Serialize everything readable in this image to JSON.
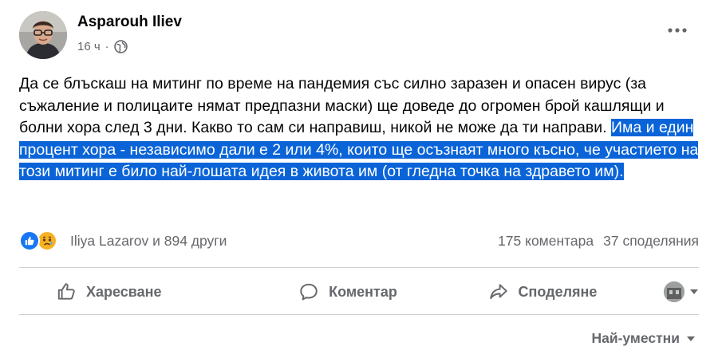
{
  "post": {
    "author": "Asparouh Iliev",
    "time": "16 ч",
    "privacy_icon": "globe-icon",
    "text_plain": "Да се блъскаш на митинг по време на пандемия със силно заразен и опасен вирус (за съжаление и полицаите нямат предпазни маски) ще доведе до огромен брой кашлящи и болни хора след 3 дни. Какво то сам си направиш, никой не може да ти направи. ",
    "text_highlighted": "Има и един процент хора - независимо дали е 2 или 4%, които ще осъзнаят много късно, че участието на този митинг е било най-лошата идея в живота им (от гледна точка на здравето им)."
  },
  "reactions": {
    "icons": [
      "like-icon",
      "sad-icon"
    ],
    "summary": "Iliya Lazarov и 894 други",
    "comments": "175 коментара",
    "shares": "37 споделяния"
  },
  "actions": {
    "like": "Харесване",
    "comment": "Коментар",
    "share": "Споделяне"
  },
  "sort": {
    "label": "Най-уместни"
  },
  "colors": {
    "highlight": "#0a64d8",
    "secondary_text": "#65676b",
    "like_blue": "#1877f2",
    "sad_yellow": "#f7b125"
  }
}
